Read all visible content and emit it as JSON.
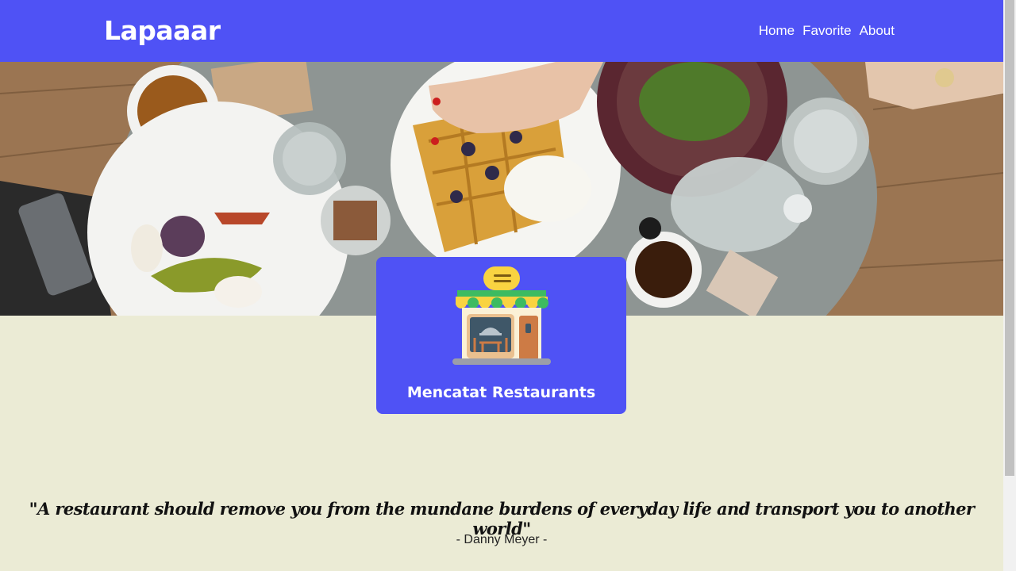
{
  "header": {
    "brand": "Lapaaar",
    "nav": [
      {
        "label": "Home"
      },
      {
        "label": "Favorite"
      },
      {
        "label": "About"
      }
    ]
  },
  "hero": {
    "image": "restaurant-table-food-photo"
  },
  "card": {
    "icon": "restaurant-storefront-icon",
    "title": "Mencatat Restaurants"
  },
  "quote": {
    "text": "\"A restaurant should remove you from the mundane burdens of everyday life and transport you to another world\"",
    "author": "- Danny Meyer -"
  },
  "colors": {
    "primary": "#4f52f5",
    "page_bg": "#ebebd5"
  }
}
